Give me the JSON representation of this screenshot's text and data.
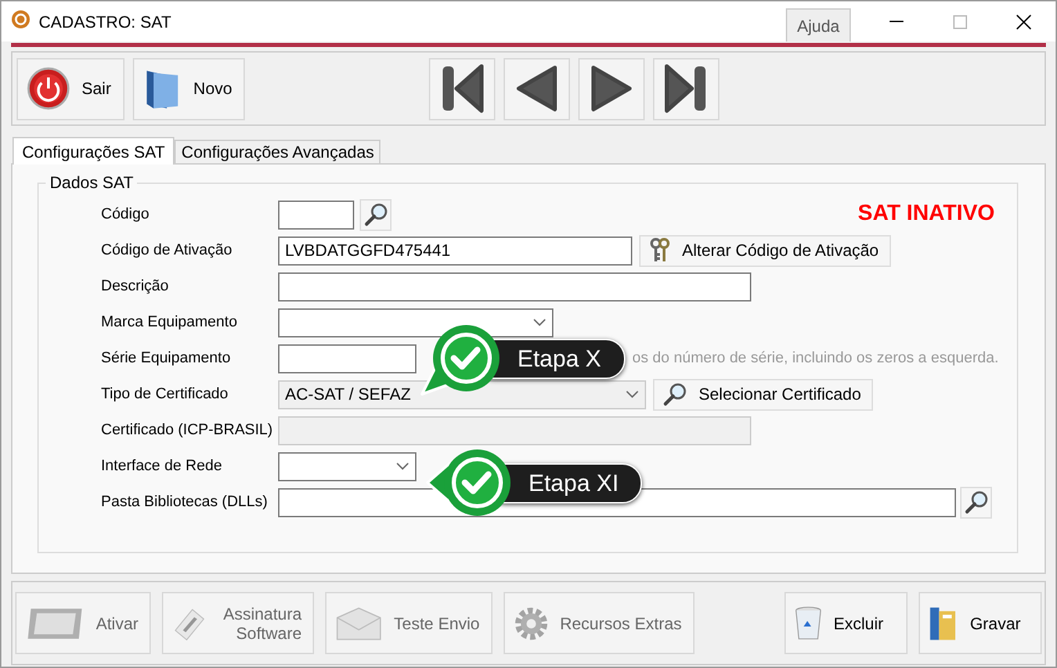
{
  "window": {
    "title": "CADASTRO: SAT",
    "help": "Ajuda"
  },
  "toolbar": {
    "buttons": [
      {
        "label": "Sair",
        "kind": "power"
      },
      {
        "label": "Novo",
        "kind": "folder"
      }
    ],
    "nav": [
      {
        "kind": "first"
      },
      {
        "kind": "prev"
      },
      {
        "kind": "next"
      },
      {
        "kind": "last"
      }
    ]
  },
  "tabs": [
    {
      "label": "Configurações SAT",
      "selected": true
    },
    {
      "label": "Configurações Avançadas",
      "selected": false
    }
  ],
  "group": {
    "title": "Dados SAT",
    "status": "SAT INATIVO"
  },
  "fields": [
    {
      "label": "Código",
      "kind": "text",
      "disabled": false,
      "action": {
        "kind": "search"
      }
    },
    {
      "label": "Código de Ativação",
      "kind": "text",
      "disabled": false,
      "value": "LVBDATGGFD475441",
      "action": {
        "kind": "keys",
        "label": "Alterar Código de Ativação"
      }
    },
    {
      "label": "Descrição",
      "kind": "text",
      "disabled": false
    },
    {
      "label": "Marca Equipamento",
      "kind": "combo",
      "disabled": false
    },
    {
      "label": "Série Equipamento",
      "kind": "text",
      "disabled": false,
      "hint": "os do número de série, incluindo os zeros a esquerda."
    },
    {
      "label": "Tipo de Certificado",
      "kind": "combo",
      "disabled": true,
      "value": "AC-SAT / SEFAZ",
      "action": {
        "kind": "search",
        "label": "Selecionar Certificado"
      }
    },
    {
      "label": "Certificado (ICP-BRASIL)",
      "kind": "text",
      "disabled": true
    },
    {
      "label": "Interface de Rede",
      "kind": "combo",
      "disabled": false
    },
    {
      "label": "Pasta Bibliotecas (DLLs)",
      "kind": "text",
      "disabled": false,
      "action": {
        "kind": "search"
      }
    }
  ],
  "bottom_buttons": [
    {
      "label": "Ativar",
      "kind": "card",
      "disabled": true
    },
    {
      "label": "Assinatura Software",
      "kind": "pen",
      "disabled": true
    },
    {
      "label": "Teste Envio",
      "kind": "envelope",
      "disabled": true
    },
    {
      "label": "Recursos Extras",
      "kind": "gear",
      "disabled": true
    },
    {
      "label": "Excluir",
      "kind": "bin",
      "disabled": false
    },
    {
      "label": "Gravar",
      "kind": "binder",
      "disabled": false
    }
  ],
  "callouts": [
    {
      "label": "Etapa X",
      "kind": "down-left"
    },
    {
      "label": "Etapa XI",
      "kind": "left"
    }
  ]
}
